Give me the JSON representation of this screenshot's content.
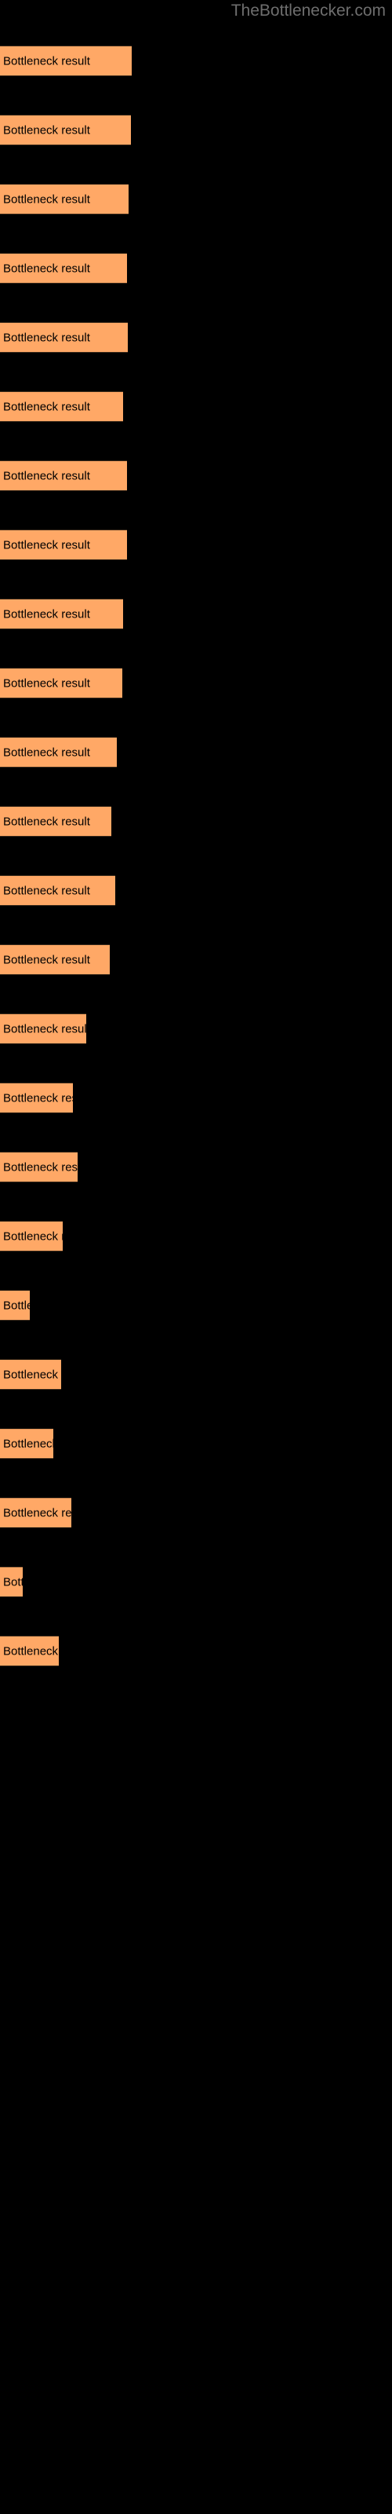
{
  "watermark": {
    "text": "TheBottlenecker.com",
    "color": "#6e6e6e"
  },
  "style": {
    "background": "#000000",
    "bar_fill": "#ffa866",
    "bar_edge": "#3a2a1a",
    "label_color": "#000000"
  },
  "chart_data": {
    "type": "bar",
    "orientation": "horizontal",
    "title": "",
    "subtitle": "",
    "xlabel": "",
    "ylabel": "",
    "grid": false,
    "legend": null,
    "axis_visible": false,
    "tick_labels": [],
    "xlim": [
      0,
      500
    ],
    "bar_label_text": "Bottleneck result",
    "categories": [
      "Bottleneck result",
      "Bottleneck result",
      "Bottleneck result",
      "Bottleneck result",
      "Bottleneck result",
      "Bottleneck result",
      "Bottleneck result",
      "Bottleneck result",
      "Bottleneck result",
      "Bottleneck result",
      "Bottleneck result",
      "Bottleneck result",
      "Bottleneck result",
      "Bottleneck result",
      "Bottleneck result",
      "Bottleneck result",
      "Bottleneck result",
      "Bottleneck result",
      "Bottleneck result",
      "Bottleneck result",
      "Bottleneck result",
      "Bottleneck result",
      "Bottleneck result",
      "Bottleneck result"
    ],
    "values": [
      168,
      167,
      164,
      162,
      163,
      157,
      162,
      162,
      157,
      156,
      149,
      142,
      147,
      140,
      110,
      93,
      99,
      80,
      38,
      78,
      68,
      91,
      29,
      75
    ],
    "bars": [
      {
        "index": 1,
        "label": "Bottleneck result",
        "width": 168,
        "top": 58
      },
      {
        "index": 2,
        "label": "Bottleneck result",
        "width": 167,
        "top": 146
      },
      {
        "index": 3,
        "label": "Bottleneck result",
        "width": 164,
        "top": 234
      },
      {
        "index": 4,
        "label": "Bottleneck result",
        "width": 162,
        "top": 322
      },
      {
        "index": 5,
        "label": "Bottleneck result",
        "width": 163,
        "top": 410
      },
      {
        "index": 6,
        "label": "Bottleneck result",
        "width": 157,
        "top": 498
      },
      {
        "index": 7,
        "label": "Bottleneck result",
        "width": 162,
        "top": 586
      },
      {
        "index": 8,
        "label": "Bottleneck result",
        "width": 162,
        "top": 674
      },
      {
        "index": 9,
        "label": "Bottleneck result",
        "width": 157,
        "top": 762
      },
      {
        "index": 10,
        "label": "Bottleneck result",
        "width": 156,
        "top": 850
      },
      {
        "index": 11,
        "label": "Bottleneck result",
        "width": 149,
        "top": 938
      },
      {
        "index": 12,
        "label": "Bottleneck result",
        "width": 142,
        "top": 1026
      },
      {
        "index": 13,
        "label": "Bottleneck result",
        "width": 147,
        "top": 1114
      },
      {
        "index": 14,
        "label": "Bottleneck result",
        "width": 140,
        "top": 1202
      },
      {
        "index": 15,
        "label": "Bottleneck result",
        "width": 110,
        "top": 1290
      },
      {
        "index": 16,
        "label": "Bottleneck result",
        "width": 93,
        "top": 1378
      },
      {
        "index": 17,
        "label": "Bottleneck result",
        "width": 99,
        "top": 1466
      },
      {
        "index": 18,
        "label": "Bottleneck result",
        "width": 80,
        "top": 1554
      },
      {
        "index": 19,
        "label": "Bottleneck result",
        "width": 38,
        "top": 1642
      },
      {
        "index": 20,
        "label": "Bottleneck result",
        "width": 78,
        "top": 1730
      },
      {
        "index": 21,
        "label": "Bottleneck result",
        "width": 68,
        "top": 1818
      },
      {
        "index": 22,
        "label": "Bottleneck result",
        "width": 91,
        "top": 1906
      },
      {
        "index": 23,
        "label": "Bottleneck result",
        "width": 29,
        "top": 1994
      },
      {
        "index": 24,
        "label": "Bottleneck result",
        "width": 75,
        "top": 2082
      }
    ]
  }
}
